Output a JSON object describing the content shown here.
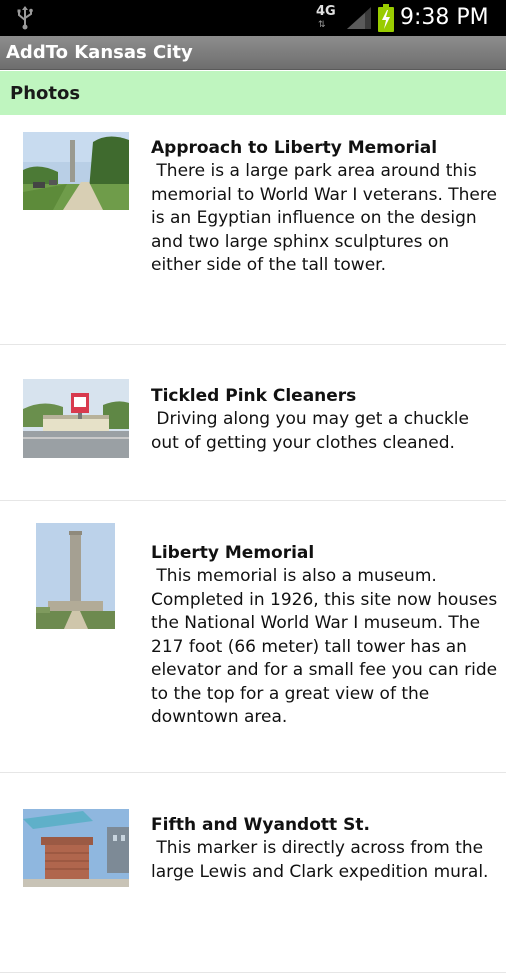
{
  "status_bar": {
    "network": "4G",
    "network_arrows": "⇅",
    "time": "9:38 PM",
    "icons": [
      "usb-icon",
      "signal-icon",
      "battery-charging-icon"
    ]
  },
  "app": {
    "title": "AddTo Kansas City"
  },
  "section": {
    "title": "Photos",
    "background": "#bff5bf"
  },
  "items": [
    {
      "title": "Approach to Liberty Memorial",
      "description": " There is a large park area around this memorial to World War I veterans. There is an Egyptian influence on the design and two large sphinx sculptures on either side of the tall tower.",
      "thumbnail": "road-to-memorial-photo"
    },
    {
      "title": "Tickled Pink Cleaners",
      "description": " Driving along you may get a chuckle out of getting your clothes cleaned.",
      "thumbnail": "dry-cleaner-building-photo"
    },
    {
      "title": "Liberty Memorial",
      "description": " This memorial is also a museum. Completed in 1926, this site now houses the National World War I museum. The 217 foot (66 meter) tall tower has an elevator and for a small fee you can ride to the top for a great view of the downtown area.",
      "thumbnail": "memorial-tower-photo"
    },
    {
      "title": "Fifth and Wyandott St.",
      "description": " This marker is directly across from the large Lewis and Clark expedition mural.",
      "thumbnail": "brick-marker-photo"
    }
  ]
}
